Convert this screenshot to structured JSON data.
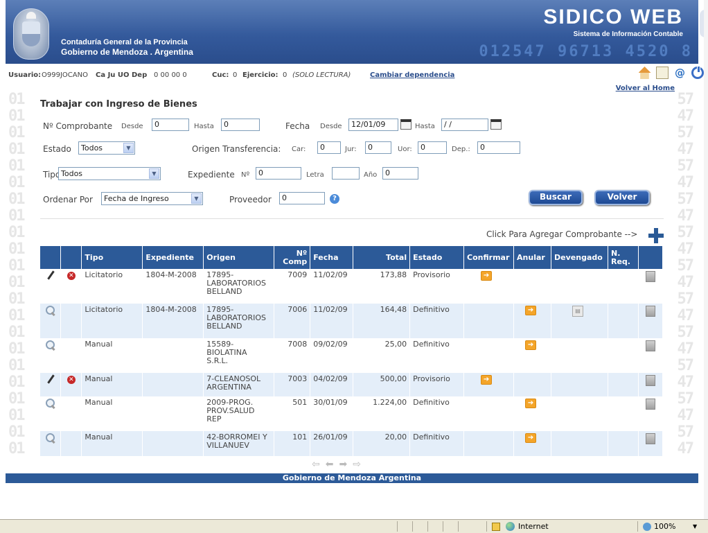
{
  "header": {
    "org_line1": "Contaduría General de la Provincia",
    "org_line2": "Gobierno de Mendoza . Argentina",
    "app_name": "SIDICO  WEB",
    "app_subtitle": "Sistema de Información Contable",
    "digits": "012547 96713 4520 8"
  },
  "userbar": {
    "usuario_label": "Usuario:",
    "usuario_value": "O999JOCANO",
    "dep_text": "Ca Ju UO Dep",
    "dep_values": "0 00 00 0",
    "cuc_label": "Cuc:",
    "cuc_value": "0",
    "ejercicio_label": "Ejercicio:",
    "ejercicio_value": "0",
    "mode": "(SOLO LECTURA)",
    "cambiar": "Cambiar dependencia",
    "volver_home": "Volver al Home"
  },
  "form": {
    "title": "Trabajar con Ingreso de Bienes",
    "comprobante_label": "Nº Comprobante",
    "desde_label": "Desde",
    "desde_value": "0",
    "hasta_label": "Hasta",
    "hasta_value": "0",
    "fecha_label": "Fecha",
    "fecha_desde_label": "Desde",
    "fecha_desde_value": "12/01/09",
    "fecha_hasta_label": "Hasta",
    "fecha_hasta_value": "/ /",
    "estado_label": "Estado",
    "estado_value": "Todos",
    "origen_label": "Origen Transferencia:",
    "car_label": "Car:",
    "car_value": "0",
    "jur_label": "Jur:",
    "jur_value": "0",
    "uor_label": "Uor:",
    "uor_value": "0",
    "dep_label": "Dep.:",
    "dep_value": "0",
    "tipo_label": "Tipo",
    "tipo_value": "Todos",
    "expediente_label": "Expediente",
    "expediente_nro_label": "Nº",
    "expediente_nro_value": "0",
    "letra_label": "Letra",
    "letra_value": "",
    "anio_label": "Año",
    "anio_value": "0",
    "ordenar_label": "Ordenar Por",
    "ordenar_value": "Fecha de Ingreso",
    "proveedor_label": "Proveedor",
    "proveedor_value": "0",
    "buscar_label": "Buscar",
    "volver_label": "Volver"
  },
  "add_label": "Click Para Agregar Comprobante -->",
  "table": {
    "headers": [
      "Tipo",
      "Expediente",
      "Origen",
      "Nº Comp",
      "Fecha",
      "Total",
      "Estado",
      "Confirmar",
      "Anular",
      "Devengado",
      "N. Req."
    ],
    "rows": [
      {
        "tipo": "Licitatorio",
        "expediente": "1804-M-2008",
        "origen": "17895-\nLABORATORIOS\nBELLAND",
        "nro": "7009",
        "fecha": "11/02/09",
        "total": "173,88",
        "estado": "Provisorio"
      },
      {
        "tipo": "Licitatorio",
        "expediente": "1804-M-2008",
        "origen": "17895-\nLABORATORIOS\nBELLAND",
        "nro": "7006",
        "fecha": "11/02/09",
        "total": "164,48",
        "estado": "Definitivo"
      },
      {
        "tipo": "Manual",
        "expediente": "",
        "origen": "15589-\nBIOLATINA\nS.R.L.",
        "nro": "7008",
        "fecha": "09/02/09",
        "total": "25,00",
        "estado": "Definitivo"
      },
      {
        "tipo": "Manual",
        "expediente": "",
        "origen": "7-CLEANOSOL\nARGENTINA",
        "nro": "7003",
        "fecha": "04/02/09",
        "total": "500,00",
        "estado": "Provisorio"
      },
      {
        "tipo": "Manual",
        "expediente": "",
        "origen": "2009-PROG.\nPROV.SALUD\nREP",
        "nro": "501",
        "fecha": "30/01/09",
        "total": "1.224,00",
        "estado": "Definitivo"
      },
      {
        "tipo": "Manual",
        "expediente": "",
        "origen": "42-BORROMEI Y\nVILLANUEV",
        "nro": "101",
        "fecha": "26/01/09",
        "total": "20,00",
        "estado": "Definitivo"
      }
    ]
  },
  "footer": "Gobierno de Mendoza Argentina",
  "statusbar": {
    "zone": "Internet",
    "zoom": "100%"
  },
  "colors": {
    "primary": "#2c5a98",
    "row_alt": "#e4eef9",
    "action_orange": "#f4a52a",
    "delete_red": "#c62828"
  }
}
